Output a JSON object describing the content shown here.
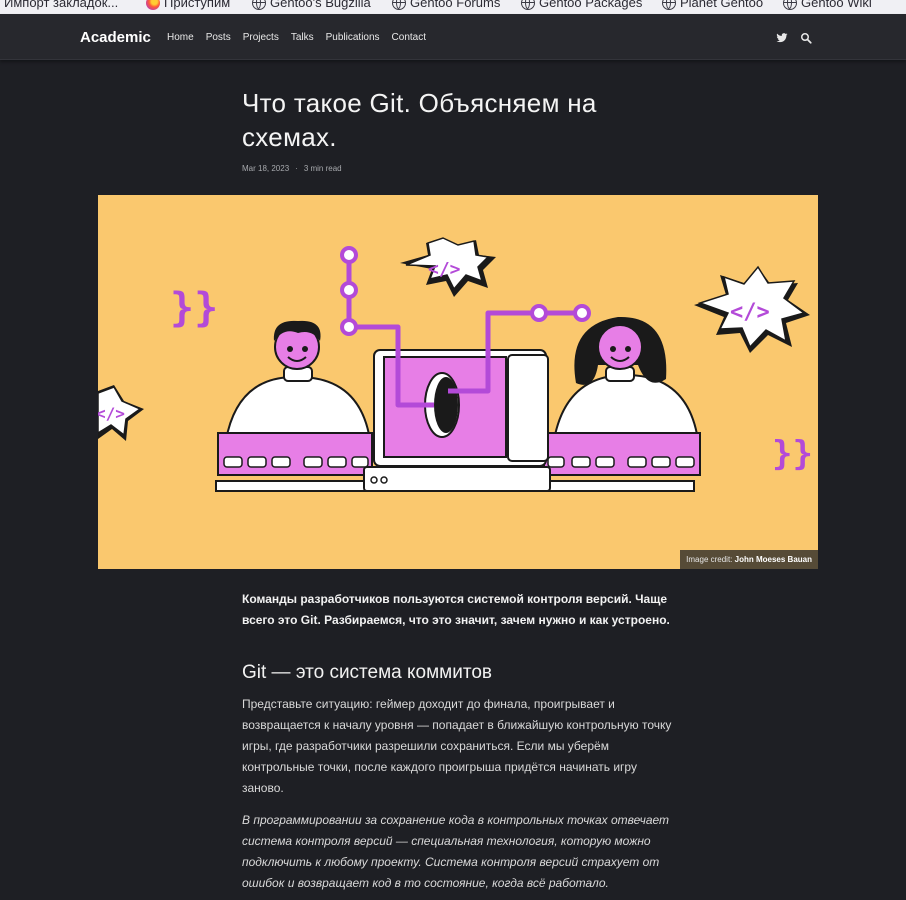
{
  "bookmarks": [
    {
      "label": "Импорт закладок...",
      "icon": "import-icon"
    },
    {
      "label": "Приступим",
      "icon": "firefox-icon"
    },
    {
      "label": "Gentoo's Bugzilla",
      "icon": "globe-icon"
    },
    {
      "label": "Gentoo Forums",
      "icon": "globe-icon"
    },
    {
      "label": "Gentoo Packages",
      "icon": "globe-icon"
    },
    {
      "label": "Planet Gentoo",
      "icon": "globe-icon"
    },
    {
      "label": "Gentoo Wiki",
      "icon": "globe-icon"
    }
  ],
  "navbar": {
    "brand": "Academic",
    "links": [
      "Home",
      "Posts",
      "Projects",
      "Talks",
      "Publications",
      "Contact"
    ],
    "icons": [
      "twitter-icon",
      "search-icon",
      "moon-icon"
    ]
  },
  "article": {
    "title": "Что такое Git. Объясняем на схемах.",
    "date": "Mar 18, 2023",
    "separator": "·",
    "read_time": "3 min read",
    "image_credit_prefix": "Image credit:",
    "image_credit_author": "John Moeses Bauan",
    "lead": "Команды разработчиков пользуются системой контроля версий. Чаще всего это Git. Разбираемся, что это значит, зачем нужно и как устроено.",
    "section_heading": "Git — это система коммитов",
    "paragraph_1": "Представьте ситуацию: геймер доходит до финала, проигрывает и возвращается к началу уровня — попадает в ближайшую контрольную точку игры, где разработчики разрешили сохраниться. Если мы уберём контрольные точки, после каждого проигрыша придётся начинать игру заново.",
    "paragraph_2": "В программировании за сохранение кода в контрольных точках отвечает система контроля версий — специальная технология, которую можно подключить к любому проекту. Система контроля версий страхует от ошибок и возвращает код в то состояние, когда всё работало."
  },
  "colors": {
    "page_bg": "#1e1f24",
    "navbar_bg": "#27282d",
    "hero_bg": "#fac86e",
    "accent_purple": "#b34ad8",
    "screen_pink": "#e77ee6"
  }
}
